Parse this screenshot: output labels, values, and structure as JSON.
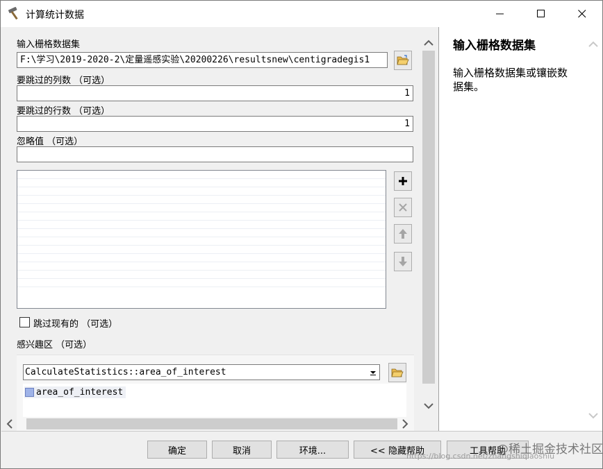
{
  "window": {
    "title": "计算统计数据",
    "icons": {
      "title": "hammer-icon",
      "minimize": "minimize-icon",
      "maximize": "maximize-icon",
      "close": "close-icon"
    }
  },
  "form": {
    "raster_label": "输入栅格数据集",
    "raster_value": "F:\\学习\\2019-2020-2\\定量遥感实验\\20200226\\resultsnew\\centigradegis1",
    "skip_cols_label": "要跳过的列数 （可选）",
    "skip_cols_value": "1",
    "skip_rows_label": "要跳过的行数 （可选）",
    "skip_rows_value": "1",
    "ignore_label": "忽略值 （可选）",
    "ignore_value": "",
    "skip_existing_label": "跳过现有的 （可选）",
    "skip_existing_checked": false,
    "roi_label": "感兴趣区 （可选）",
    "roi_value": "CalculateStatistics::area_of_interest",
    "roi_layer": "area_of_interest",
    "list_icons": [
      "add-icon",
      "remove-icon",
      "move-up-icon",
      "move-down-icon"
    ]
  },
  "help": {
    "title": "输入栅格数据集",
    "body": "输入栅格数据集或镶嵌数据集。"
  },
  "buttons": {
    "ok": "确定",
    "cancel": "取消",
    "environments": "环境...",
    "hide_help": "<< 隐藏帮助",
    "tool_help": "工具帮助"
  },
  "watermark": {
    "text": "@稀土掘金技术社区",
    "url": "https://blog.csdn.net/zhangshiqiaoshiu"
  },
  "colors": {
    "folder": "#e8b64a",
    "scroll_thumb": "#cdcdcd",
    "layer_swatch": "#9fb3e8"
  }
}
